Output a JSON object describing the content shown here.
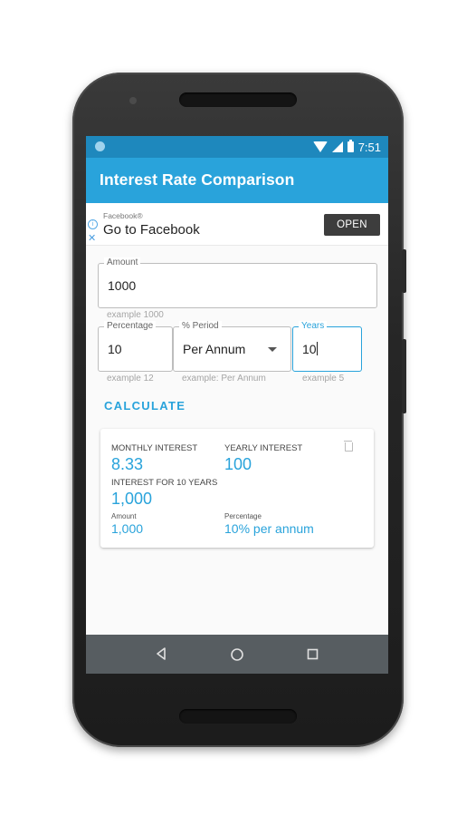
{
  "status_bar": {
    "time": "7:51"
  },
  "app_bar": {
    "title": "Interest Rate Comparison"
  },
  "ad": {
    "sponsor": "Facebook®",
    "headline": "Go to Facebook",
    "cta_label": "OPEN"
  },
  "form": {
    "amount": {
      "label": "Amount",
      "value": "1000",
      "helper": "example 1000"
    },
    "percentage": {
      "label": "Percentage",
      "value": "10",
      "helper": "example 12"
    },
    "period": {
      "label": "% Period",
      "value": "Per Annum",
      "helper": "example: Per Annum"
    },
    "years": {
      "label": "Years",
      "value": "10",
      "helper": "example 5"
    }
  },
  "calculate_label": "CALCULATE",
  "result": {
    "monthly_label": "MONTHLY INTEREST",
    "monthly_value": "8.33",
    "yearly_label": "YEARLY INTEREST",
    "yearly_value": "100",
    "period_label": "INTEREST FOR 10 YEARS",
    "period_value": "1,000",
    "amount_label": "Amount",
    "amount_value": "1,000",
    "percentage_label": "Percentage",
    "percentage_value": "10% per annum"
  },
  "icons": {
    "status": [
      "app-notification-icon",
      "wifi-icon",
      "signal-icon",
      "battery-icon"
    ],
    "ad": [
      "ad-info-icon",
      "ad-close-icon"
    ],
    "card": [
      "trash-icon"
    ],
    "nav": [
      "back-icon",
      "home-icon",
      "recents-icon"
    ]
  },
  "colors": {
    "primary": "#29a3db",
    "status_bar": "#1e88bd",
    "nav_bar": "#575d61",
    "ad_button": "#3d3d3d"
  }
}
